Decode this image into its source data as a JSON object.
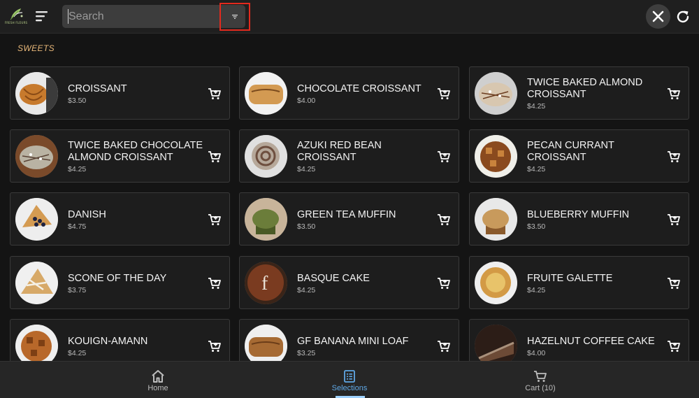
{
  "header": {
    "logo_text": "FRESH FLOURS",
    "search_placeholder": "Search"
  },
  "section": {
    "title": "SWEETS"
  },
  "products": [
    {
      "name": "CROISSANT",
      "price": "$3.50"
    },
    {
      "name": "CHOCOLATE CROISSANT",
      "price": "$4.00"
    },
    {
      "name": "TWICE BAKED ALMOND CROISSANT",
      "price": "$4.25"
    },
    {
      "name": "TWICE BAKED CHOCOLATE ALMOND CROISSANT",
      "price": "$4.25"
    },
    {
      "name": "AZUKI RED BEAN CROISSANT",
      "price": "$4.25"
    },
    {
      "name": "PECAN CURRANT CROISSANT",
      "price": "$4.25"
    },
    {
      "name": "DANISH",
      "price": "$4.75"
    },
    {
      "name": "GREEN TEA MUFFIN",
      "price": "$3.50"
    },
    {
      "name": "BLUEBERRY MUFFIN",
      "price": "$3.50"
    },
    {
      "name": "SCONE OF THE DAY",
      "price": "$3.75"
    },
    {
      "name": "BASQUE CAKE",
      "price": "$4.25"
    },
    {
      "name": "FRUITE GALETTE",
      "price": "$4.25"
    },
    {
      "name": "KOUIGN-AMANN",
      "price": "$4.25"
    },
    {
      "name": "GF BANANA MINI LOAF",
      "price": "$3.25"
    },
    {
      "name": "HAZELNUT COFFEE CAKE",
      "price": "$4.00"
    }
  ],
  "nav": {
    "home": "Home",
    "selections": "Selections",
    "cart": "Cart (10)"
  }
}
